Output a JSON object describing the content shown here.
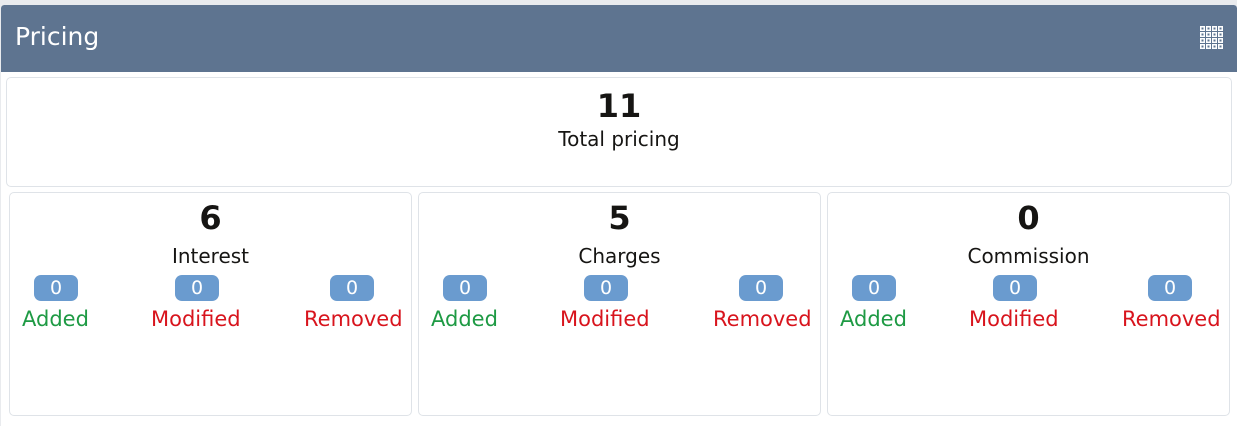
{
  "header": {
    "title": "Pricing",
    "icon": "grid-icon"
  },
  "total": {
    "value": "11",
    "label": "Total pricing"
  },
  "cards": [
    {
      "value": "6",
      "label": "Interest",
      "added": {
        "count": "0",
        "label": "Added"
      },
      "modified": {
        "count": "0",
        "label": "Modified"
      },
      "removed": {
        "count": "0",
        "label": "Removed"
      }
    },
    {
      "value": "5",
      "label": "Charges",
      "added": {
        "count": "0",
        "label": "Added"
      },
      "modified": {
        "count": "0",
        "label": "Modified"
      },
      "removed": {
        "count": "0",
        "label": "Removed"
      }
    },
    {
      "value": "0",
      "label": "Commission",
      "added": {
        "count": "0",
        "label": "Added"
      },
      "modified": {
        "count": "0",
        "label": "Modified"
      },
      "removed": {
        "count": "0",
        "label": "Removed"
      }
    }
  ],
  "colors": {
    "header_bg": "#5e7490",
    "badge_bg": "#6a9bcf",
    "added": "#1e9a44",
    "modified": "#d8141d",
    "removed": "#d8141d"
  }
}
